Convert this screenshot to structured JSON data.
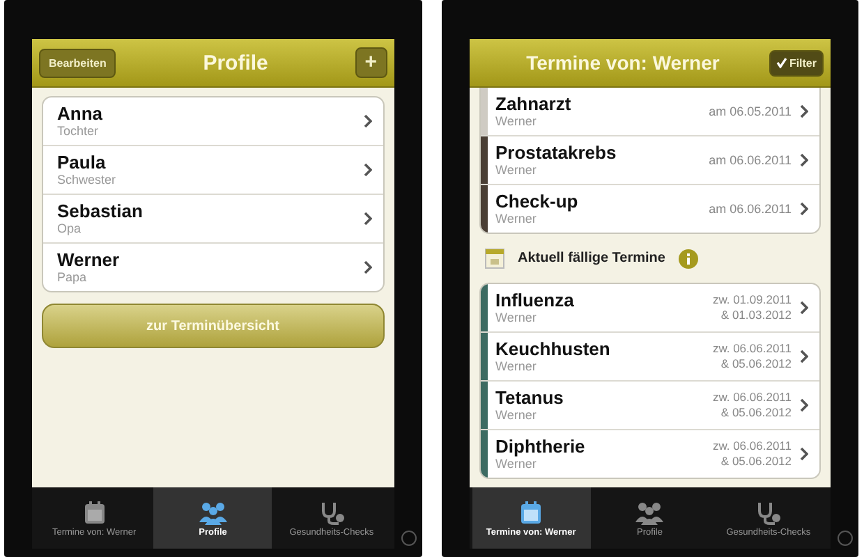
{
  "profile_screen": {
    "nav": {
      "title": "Profile",
      "left_button": "Bearbeiten",
      "right_button": "+"
    },
    "profiles": [
      {
        "name": "Anna",
        "relation": "Tochter"
      },
      {
        "name": "Paula",
        "relation": "Schwester"
      },
      {
        "name": "Sebastian",
        "relation": "Opa"
      },
      {
        "name": "Werner",
        "relation": "Papa"
      }
    ],
    "action_button": "zur Terminübersicht",
    "tabs": [
      {
        "label": "Termine von: Werner",
        "selected": false
      },
      {
        "label": "Profile",
        "selected": true
      },
      {
        "label": "Gesundheits-Checks",
        "selected": false
      }
    ]
  },
  "appointments_screen": {
    "nav": {
      "title": "Termine von: Werner",
      "filter_button": "Filter"
    },
    "appointments": [
      {
        "title": "Zahnarzt",
        "person": "Werner",
        "date": "am 06.05.2011",
        "color": "#cfcbc3"
      },
      {
        "title": "Prostatakrebs",
        "person": "Werner",
        "date": "am 06.06.2011",
        "color": "#4a3f35"
      },
      {
        "title": "Check-up",
        "person": "Werner",
        "date": "am 06.06.2011",
        "color": "#4a3f35"
      }
    ],
    "section_title": "Aktuell fällige Termine",
    "due": [
      {
        "title": "Influenza",
        "person": "Werner",
        "date_from": "zw. 01.09.2011",
        "date_to": "& 01.03.2012",
        "color": "#3d6b62"
      },
      {
        "title": "Keuchhusten",
        "person": "Werner",
        "date_from": "zw. 06.06.2011",
        "date_to": "& 05.06.2012",
        "color": "#3d6b62"
      },
      {
        "title": "Tetanus",
        "person": "Werner",
        "date_from": "zw. 06.06.2011",
        "date_to": "& 05.06.2012",
        "color": "#3d6b62"
      },
      {
        "title": "Diphtherie",
        "person": "Werner",
        "date_from": "zw. 06.06.2011",
        "date_to": "& 05.06.2012",
        "color": "#3d6b62"
      }
    ],
    "tabs": [
      {
        "label": "Termine von: Werner",
        "selected": true
      },
      {
        "label": "Profile",
        "selected": false
      },
      {
        "label": "Gesundheits-Checks",
        "selected": false
      }
    ]
  }
}
